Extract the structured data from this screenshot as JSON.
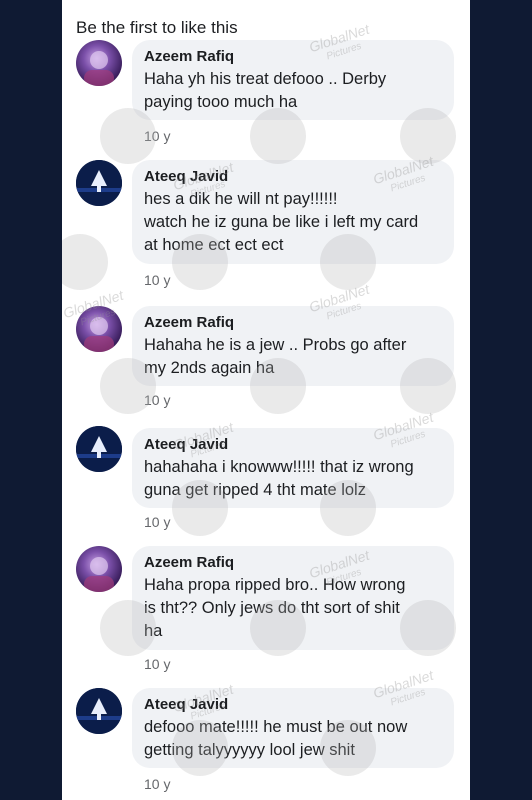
{
  "header": {
    "likes_text": "Be the first to like this"
  },
  "comments": [
    {
      "author": "Azeem Rafiq",
      "avatar": "azeem",
      "lines": [
        "Haha yh his treat defooo .. Derby",
        "paying tooo much ha"
      ],
      "age": "10 y"
    },
    {
      "author": "Ateeq Javid",
      "avatar": "ateeq",
      "lines": [
        "hes a dik he will nt pay!!!!!!",
        "watch he iz guna be like i left my card",
        "at home ect ect ect"
      ],
      "age": "10 y"
    },
    {
      "author": "Azeem Rafiq",
      "avatar": "azeem",
      "lines": [
        "Hahaha he is a jew .. Probs go after",
        "my 2nds again ha"
      ],
      "age": "10 y"
    },
    {
      "author": "Ateeq Javid",
      "avatar": "ateeq",
      "lines": [
        "hahahaha i knowww!!!!! that iz wrong",
        "guna get ripped 4 tht mate lolz"
      ],
      "age": "10 y"
    },
    {
      "author": "Azeem Rafiq",
      "avatar": "azeem",
      "lines": [
        "Haha propa ripped bro.. How wrong",
        "is tht?? Only jews do tht sort of shit",
        "ha"
      ],
      "age": "10 y"
    },
    {
      "author": "Ateeq Javid",
      "avatar": "ateeq",
      "lines": [
        "defooo mate!!!!! he must be out now",
        "getting talyyyyyy lool jew shit"
      ],
      "age": "10 y"
    }
  ],
  "watermark": {
    "brand": "GlobalNet",
    "sub": "Pictures"
  },
  "colors": {
    "background": "#0f1a33",
    "bubble": "#f0f2f5",
    "text": "#1c1e21",
    "meta": "#65676b"
  }
}
